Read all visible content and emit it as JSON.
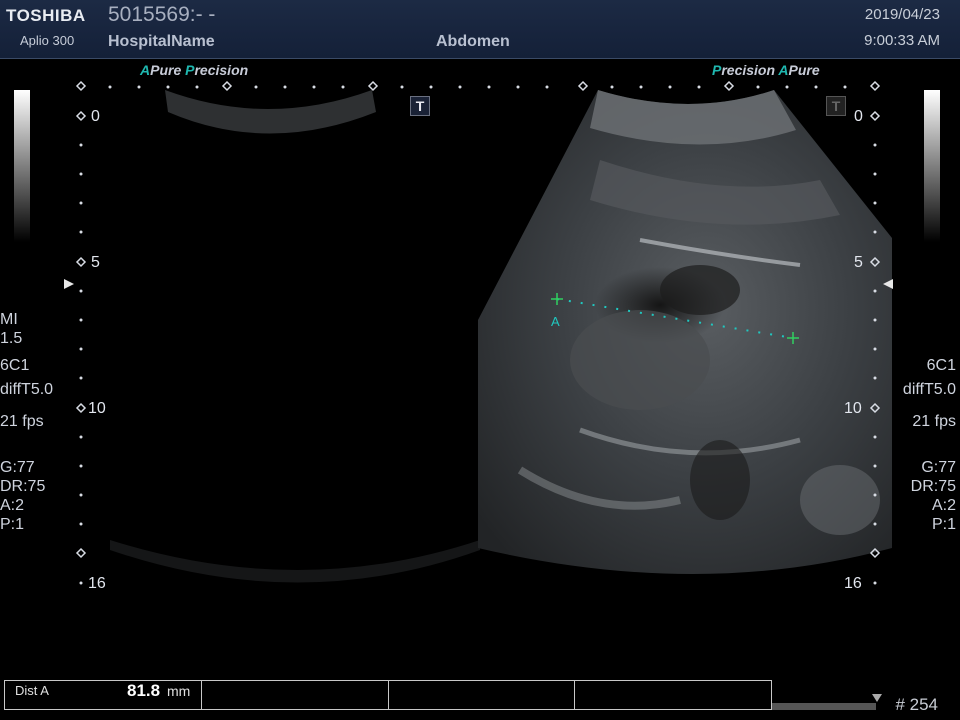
{
  "header": {
    "brand": "TOSHIBA",
    "model": "Aplio 300",
    "patient_id": "5015569:- -",
    "hospital": "HospitalName",
    "exam": "Abdomen",
    "date": "2019/04/23",
    "time": "9:00:33 AM"
  },
  "left_tag": {
    "a1": "A",
    "t1": "Pure",
    "a2": "P",
    "t2": "recision"
  },
  "right_tag": {
    "a1": "P",
    "t1": "recision",
    "a2": "A",
    "t2": "Pure"
  },
  "depth_labels": {
    "d0": "0",
    "d5": "5",
    "d10": "10",
    "d16": "16"
  },
  "left_params": {
    "mi_label": "MI",
    "mi_value": "1.5",
    "probe": "6C1",
    "mode": "diffT5.0",
    "fps": "21 fps",
    "gain": "G:77",
    "dr": "DR:75",
    "a": "A:2",
    "p": "P:1"
  },
  "right_params": {
    "probe": "6C1",
    "mode": "diffT5.0",
    "fps": "21 fps",
    "gain": "G:77",
    "dr": "DR:75",
    "a": "A:2",
    "p": "P:1"
  },
  "trackball_icon": "T",
  "caliper": {
    "label": "A"
  },
  "measurement": {
    "label": "Dist A",
    "value": "81.8",
    "unit": "mm"
  },
  "frame_number": "# 254",
  "icons": {
    "depth_marker": "triangle-marker-icon",
    "trackball": "t-box-icon",
    "caliper": "crosshair-icon"
  },
  "colors": {
    "header_bg": "#142038",
    "accent": "#1fb8b0",
    "caliper": "#20c8c0"
  }
}
